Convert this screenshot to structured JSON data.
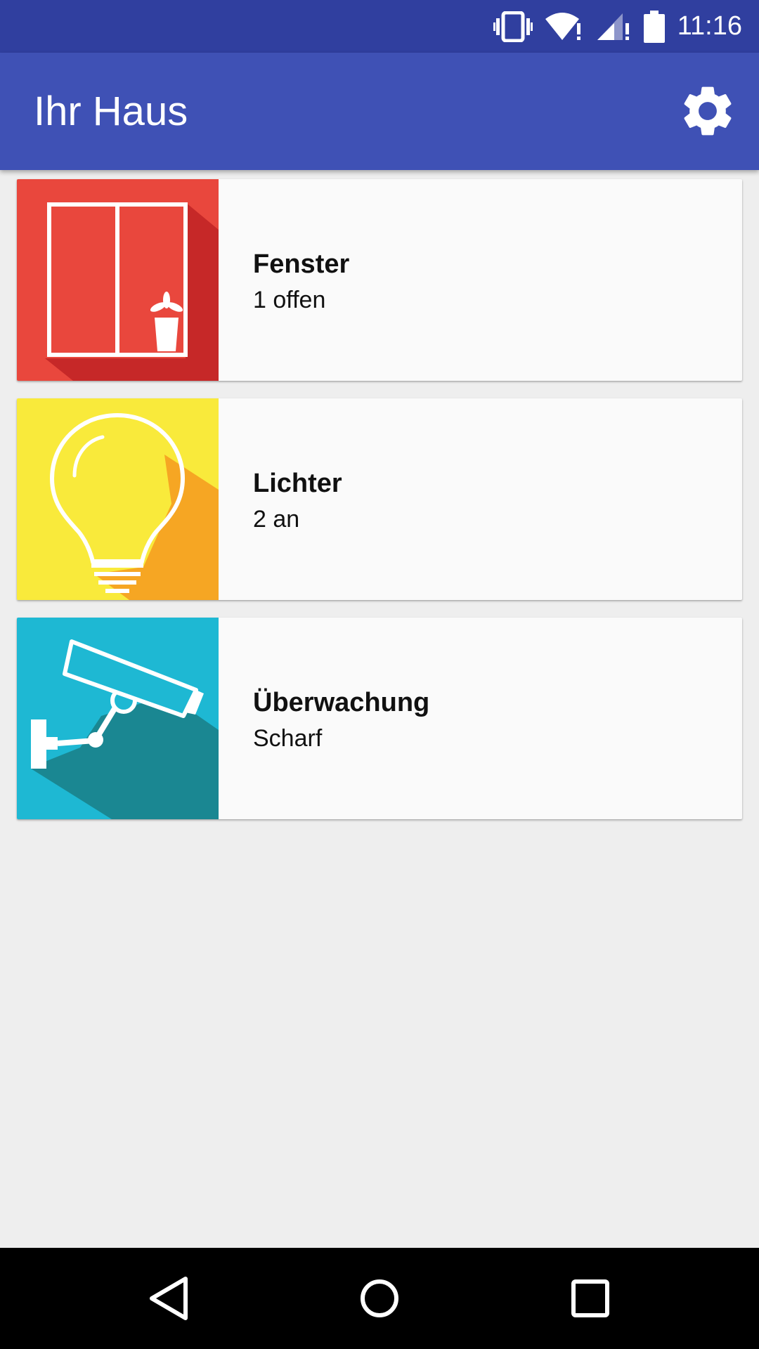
{
  "status_bar": {
    "time": "11:16",
    "icons": [
      "vibrate-icon",
      "wifi-icon",
      "signal-icon",
      "battery-icon"
    ]
  },
  "app_bar": {
    "title": "Ihr Haus",
    "action_icon": "gear-icon",
    "background": "#3f51b5",
    "status_background": "#303f9f"
  },
  "cards": [
    {
      "name": "Fenster",
      "status": "1 offen",
      "icon": "window-icon",
      "color": "#e9473d",
      "shadow": "#c62828"
    },
    {
      "name": "Lichter",
      "status": "2 an",
      "icon": "lightbulb-icon",
      "color": "#f9ea3b",
      "shadow": "#f6a623"
    },
    {
      "name": "Überwachung",
      "status": "Scharf",
      "icon": "security-camera-icon",
      "color": "#1eb8d3",
      "shadow": "#1a8792"
    }
  ],
  "nav_bar": {
    "buttons": [
      "back-icon",
      "home-icon",
      "recents-icon"
    ]
  }
}
